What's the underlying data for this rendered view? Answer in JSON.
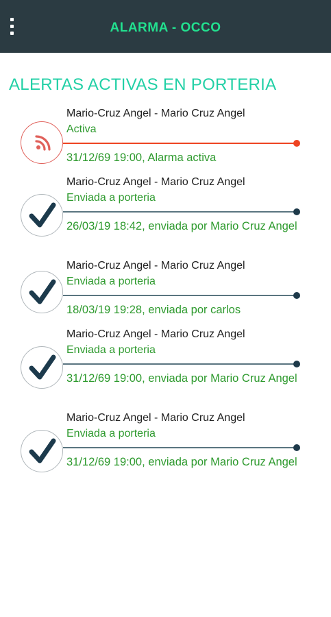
{
  "appbar": {
    "title": "ALARMA - OCCO",
    "menu_icon": "more-vert-icon"
  },
  "section_title": "ALERTAS ACTIVAS EN PORTERIA",
  "colors": {
    "appbar_bg": "#2b3b42",
    "accent": "#22e08f",
    "status_green": "#2e9a2e",
    "active_red": "#ee4422",
    "line_dark": "#1e3a4a"
  },
  "alerts": [
    {
      "name": "Mario-Cruz Angel - Mario Cruz Angel",
      "status": "Activa",
      "detail": "31/12/69 19:00, Alarma activa",
      "icon": "alarm-signal-icon",
      "active": true
    },
    {
      "name": "Mario-Cruz Angel - Mario Cruz Angel",
      "status": "Enviada a porteria",
      "detail": "26/03/19 18:42, enviada por  Mario Cruz Angel",
      "icon": "check-icon",
      "active": false
    },
    {
      "name": "Mario-Cruz Angel - Mario Cruz Angel",
      "status": "Enviada a porteria",
      "detail": "18/03/19 19:28, enviada por  carlos",
      "icon": "check-icon",
      "active": false
    },
    {
      "name": "Mario-Cruz Angel - Mario Cruz Angel",
      "status": "Enviada a porteria",
      "detail": "31/12/69 19:00, enviada por  Mario Cruz Angel",
      "icon": "check-icon",
      "active": false
    },
    {
      "name": "Mario-Cruz Angel - Mario Cruz Angel",
      "status": "Enviada a porteria",
      "detail": "31/12/69 19:00, enviada por  Mario Cruz Angel",
      "icon": "check-icon",
      "active": false
    }
  ]
}
